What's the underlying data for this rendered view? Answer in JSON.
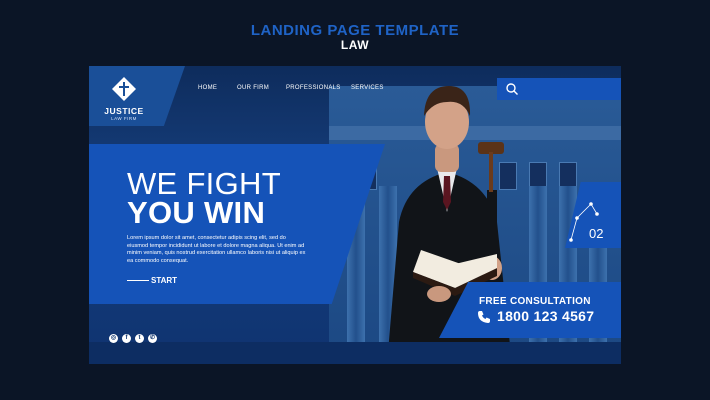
{
  "header": {
    "title": "LANDING PAGE TEMPLATE",
    "subtitle": "LAW"
  },
  "logo": {
    "name": "JUSTICE",
    "tagline": "LAW FIRM"
  },
  "nav": {
    "items": [
      {
        "label": "HOME"
      },
      {
        "label": "OUR FIRM"
      },
      {
        "label": "PROFESSIONALS"
      },
      {
        "label": "SERVICES"
      }
    ]
  },
  "hero": {
    "line1": "WE FIGHT",
    "line2": "YOU WIN",
    "body": "Lorem ipsum dolor sit amet, consectetur adipis scing elit, sed do eiusmod tempor incididunt ut labore et dolore magna aliqua. Ut enim ad minim veniam, quis nostrud exercitation ullamco laboris nisi ut aliquip ex ea commodo consequat.",
    "cta": "START"
  },
  "badge": {
    "number": "02"
  },
  "consultation": {
    "title": "FREE CONSULTATION",
    "phone": "1800 123 4567"
  },
  "social": {
    "icons": [
      "instagram-icon",
      "facebook-icon",
      "twitter-icon",
      "whatsapp-icon"
    ]
  },
  "colors": {
    "accent": "#1553b8",
    "background": "#0b1526",
    "header_title": "#1f63c6"
  }
}
